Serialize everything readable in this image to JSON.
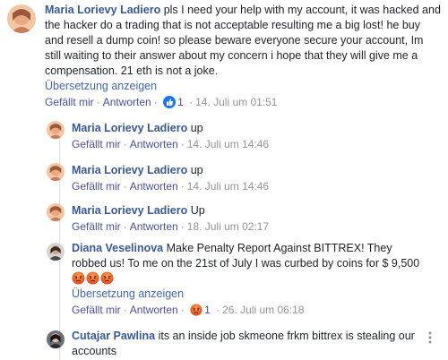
{
  "comments": [
    {
      "author": "Maria Lorievy Ladiero",
      "text": "pls I need your help with my account, it was hacked and the hacker do a trading that is not acceptable resulting me a big lost! he buy and resell a dump coin! so please beware everyone secure your account, Im still waiting to their answer about my concern i hope that they will give me a compensation. 21 eth is not a joke.",
      "translate": "Übersetzung anzeigen",
      "like": "Gefällt mir",
      "reply": "Antworten",
      "reaction_count": "1",
      "time": "14. Juli um 01:51"
    }
  ],
  "replies": [
    {
      "author": "Maria Lorievy Ladiero",
      "text": "up",
      "like": "Gefällt mir",
      "reply": "Antworten",
      "time": "14. Juli um 14:46"
    },
    {
      "author": "Maria Lorievy Ladiero",
      "text": "up",
      "like": "Gefällt mir",
      "reply": "Antworten",
      "time": "14. Juli um 14:46"
    },
    {
      "author": "Maria Lorievy Ladiero",
      "text": "Up",
      "like": "Gefällt mir",
      "reply": "Antworten",
      "time": "18. Juli um 02:17"
    },
    {
      "author": "Diana Veselinova",
      "text": "Make Penalty Report Against BITTREX! They robbed us! To me on the 21st of July I was curbed by coins for $ 9,500",
      "translate": "Übersetzung anzeigen",
      "like": "Gefällt mir",
      "reply": "Antworten",
      "reaction_count": "1",
      "time": "26. Juli um 06:18"
    },
    {
      "author": "Cutajar Pawlina",
      "text": "its an inside job skmeone frkm bittrex is stealing our accounts"
    }
  ],
  "icons": {
    "like_reaction": "thumbs-up-icon",
    "angry_reaction": "angry-face-icon",
    "angry_emoji": "angry-face-emoji"
  },
  "colors": {
    "author": "#385898",
    "link": "#4b4f9c",
    "timestamp": "#90949c",
    "like_badge": "#1877f2",
    "angry": "#e9710f"
  }
}
